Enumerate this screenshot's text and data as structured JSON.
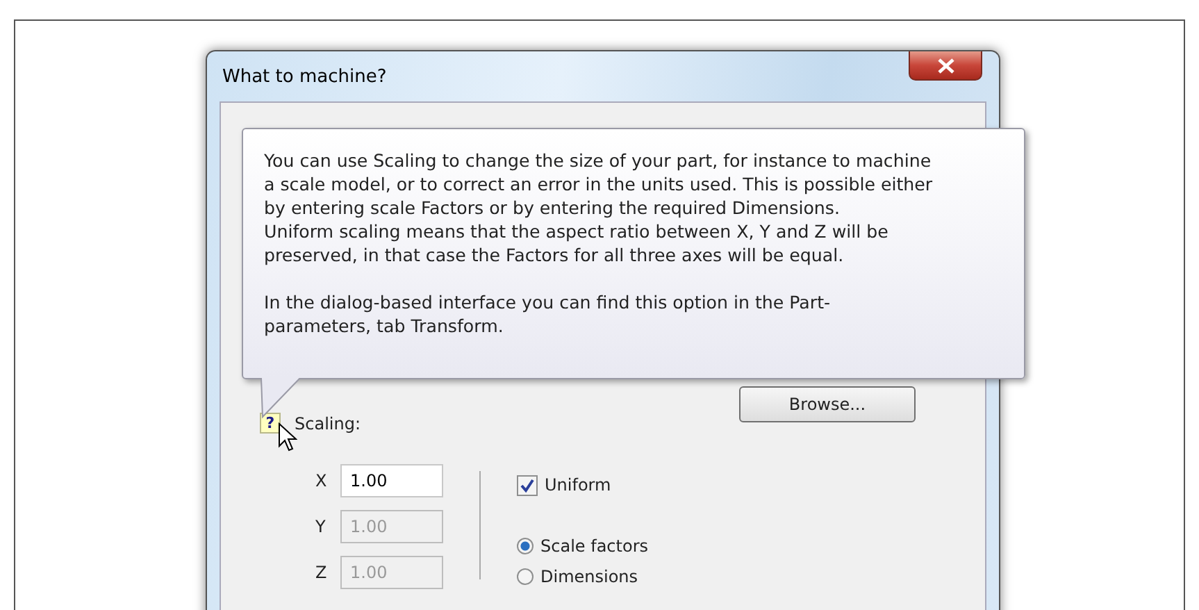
{
  "dialog": {
    "title": "What to machine?"
  },
  "tooltip": {
    "paragraphs": [
      [
        "You can use Scaling to change the size of your part, for instance to machine",
        "a scale model, or to correct an error in the units used. This is possible either",
        "by entering scale Factors or by entering the required Dimensions.",
        "Uniform scaling means that the aspect ratio between X, Y and Z will be",
        "preserved, in that case the Factors for all three axes will be equal."
      ],
      [
        "In the dialog-based interface you can find this option in the Part-",
        "parameters, tab Transform."
      ]
    ]
  },
  "browse_button": "Browse...",
  "scaling": {
    "help": "?",
    "label": "Scaling:",
    "fields": [
      {
        "axis": "X",
        "value": "1.00",
        "disabled": false
      },
      {
        "axis": "Y",
        "value": "1.00",
        "disabled": true
      },
      {
        "axis": "Z",
        "value": "1.00",
        "disabled": true
      }
    ],
    "uniform": {
      "label": "Uniform",
      "checked": true
    },
    "modes": [
      {
        "label": "Scale factors",
        "selected": true
      },
      {
        "label": "Dimensions",
        "selected": false
      }
    ]
  }
}
